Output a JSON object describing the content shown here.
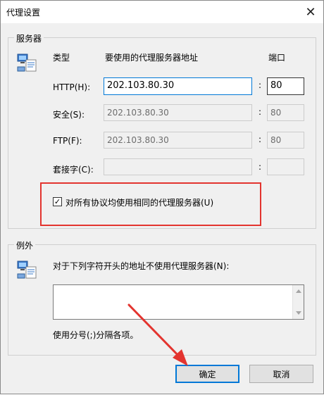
{
  "window": {
    "title": "代理设置",
    "close_glyph": "✕"
  },
  "servers": {
    "legend": "服务器",
    "type_header": "类型",
    "address_header": "要使用的代理服务器地址",
    "port_header": "端口",
    "colon": ":",
    "rows": [
      {
        "label": "HTTP(H):",
        "address": "202.103.80.30",
        "port": "80",
        "enabled": true
      },
      {
        "label": "安全(S):",
        "address": "202.103.80.30",
        "port": "80",
        "enabled": false
      },
      {
        "label": "FTP(F):",
        "address": "202.103.80.30",
        "port": "80",
        "enabled": false
      },
      {
        "label": "套接字(C):",
        "address": "",
        "port": "",
        "enabled": false
      }
    ],
    "same_proxy_label": "对所有协议均使用相同的代理服务器(U)",
    "same_proxy_checked": true,
    "check_glyph": "✓"
  },
  "exceptions": {
    "legend": "例外",
    "description": "对于下列字符开头的地址不使用代理服务器(N):",
    "value": "",
    "hint": "使用分号(;)分隔各项。"
  },
  "buttons": {
    "ok": "确定",
    "cancel": "取消"
  },
  "colors": {
    "highlight": "#e3342f",
    "accent": "#0078d7"
  }
}
